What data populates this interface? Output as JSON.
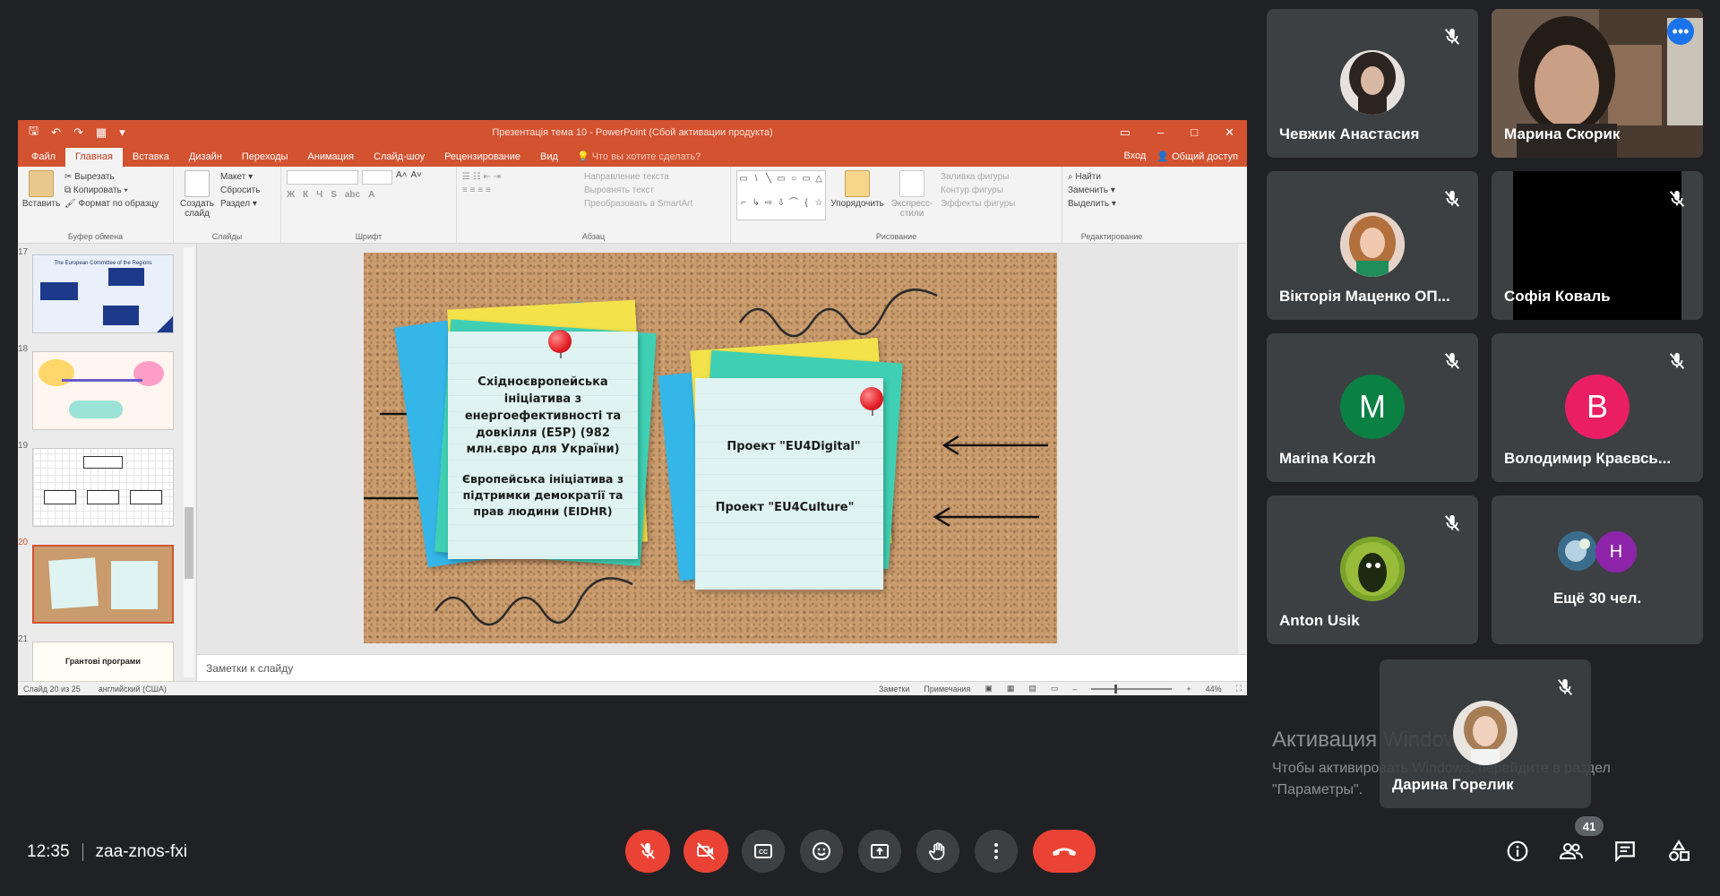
{
  "ppt": {
    "window_title": "Презентація тема 10 - PowerPoint (Сбой активации продукта)",
    "tabs": [
      "Файл",
      "Главная",
      "Вставка",
      "Дизайн",
      "Переходы",
      "Анимация",
      "Слайд-шоу",
      "Рецензирование",
      "Вид"
    ],
    "tell_me": "Что вы хотите сделать?",
    "sign_in": "Вход",
    "share": "Общий доступ",
    "ribbon": {
      "paste": "Вставить",
      "cut": "Вырезать",
      "copy": "Копировать",
      "format_painter": "Формат по образцу",
      "clipboard_group": "Буфер обмена",
      "new_slide": "Создать слайд",
      "layout": "Макет",
      "reset": "Сбросить",
      "section": "Раздел",
      "slides_group": "Слайды",
      "font_group": "Шрифт",
      "text_direction": "Направление текста",
      "align_text": "Выровнять текст",
      "smartart": "Преобразовать в SmartArt",
      "paragraph_group": "Абзац",
      "arrange": "Упорядочить",
      "quick_styles": "Экспресс-стили",
      "shape_fill": "Заливка фигуры",
      "shape_outline": "Контур фигуры",
      "shape_effects": "Эффекты фигуры",
      "drawing_group": "Рисование",
      "find": "Найти",
      "replace": "Заменить",
      "select": "Выделить",
      "editing_group": "Редактирование"
    },
    "thumbnails": [
      {
        "num": "17",
        "caption": "The European Committee of the Regions"
      },
      {
        "num": "18",
        "caption": ""
      },
      {
        "num": "19",
        "caption": ""
      },
      {
        "num": "20",
        "caption": ""
      },
      {
        "num": "21",
        "caption": "Грантові програми"
      }
    ],
    "slide": {
      "note_left_1": "Східноєвропейська ініціатива з енергоефективності та довкілля (E5P) (982 млн.євро для України)",
      "note_left_2": "Європейська ініціатива з підтримки демократії та прав людини (EIDHR)",
      "note_right_1": "Проект \"EU4Digital\"",
      "note_right_2": "Проект \"EU4Culture\""
    },
    "notes_placeholder": "Заметки к слайду",
    "status": {
      "slide_of": "Слайд 20 из 25",
      "language": "английский (США)",
      "notes": "Заметки",
      "comments": "Примечания",
      "zoom": "44%"
    }
  },
  "participants": [
    {
      "name": "Чевжик Анастасия",
      "muted": true
    },
    {
      "name": "Марина Скорик",
      "muted": false
    },
    {
      "name": "Вікторія Маценко ОП...",
      "muted": true
    },
    {
      "name": "Софія Коваль",
      "muted": true
    },
    {
      "name": "Marina Korzh",
      "initial": "M",
      "color": "#0b8043",
      "muted": true
    },
    {
      "name": "Володимир Краєвсь...",
      "initial": "В",
      "color": "#e91e63",
      "muted": true
    },
    {
      "name": "Anton Usik",
      "muted": true
    },
    {
      "more_label": "Ещё 30 чел.",
      "initial": "H",
      "color": "#8e24aa"
    },
    {
      "name": "Дарина Горелик",
      "muted": true
    }
  ],
  "watermark": {
    "title": "Активация Windows",
    "body": "Чтобы активировать Windows, перейдите в раздел \"Параметры\"."
  },
  "meeting": {
    "time": "12:35",
    "code": "zaa-znos-fxi",
    "participant_count": "41"
  },
  "colors": {
    "ppt_accent": "#d35230",
    "meet_bg": "#202124",
    "tile_bg": "#3c4043",
    "danger": "#ea4335",
    "speaking_outline": "#8ab4f8"
  }
}
